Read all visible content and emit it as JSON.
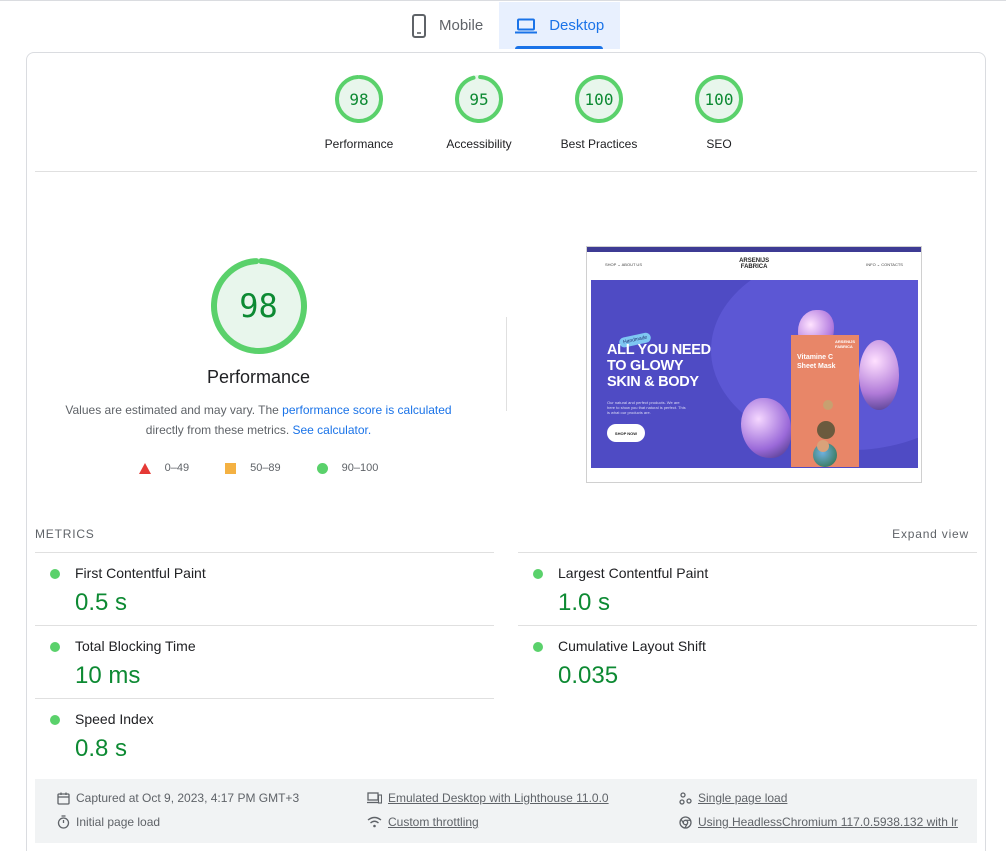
{
  "tabs": [
    {
      "label": "Mobile",
      "icon": "phone-icon",
      "active": false
    },
    {
      "label": "Desktop",
      "icon": "laptop-icon",
      "active": true
    }
  ],
  "scores": [
    {
      "value": "98",
      "label": "Performance",
      "fraction": 0.98
    },
    {
      "value": "95",
      "label": "Accessibility",
      "fraction": 0.95
    },
    {
      "value": "100",
      "label": "Best Practices",
      "fraction": 1.0
    },
    {
      "value": "100",
      "label": "SEO",
      "fraction": 1.0
    }
  ],
  "performance": {
    "score": "98",
    "fraction": 0.98,
    "title": "Performance",
    "desc_part1": "Values are estimated and may vary. The ",
    "desc_link1": "performance score is calculated",
    "desc_part2": " directly from these metrics. ",
    "desc_link2": "See calculator."
  },
  "legend": [
    {
      "range": "0–49",
      "shape": "triangle",
      "color": "#e53935"
    },
    {
      "range": "50–89",
      "shape": "square",
      "color": "#f4b142"
    },
    {
      "range": "90–100",
      "shape": "circle",
      "color": "#5ad16b"
    }
  ],
  "thumbnail": {
    "brand_line1": "ARSENIJS",
    "brand_line2": "FABRICA",
    "nav_left": "SHOP ⌄   ABOUT US",
    "nav_right": "INFO ⌄   CONTACTS",
    "badge": "Handmade",
    "hero_line1": "ALL YOU NEED",
    "hero_line2": "TO GLOWY",
    "hero_line3": "SKIN & BODY",
    "hero_small": "Our natural and perfect products. We are here to show you that natural is perfect. This is what our products are.",
    "hero_button": "SHOP NOW",
    "box_title_line1": "Vitamine C",
    "box_title_line2": "Sheet Mask",
    "box_brand_line1": "ARSENIJS",
    "box_brand_line2": "FABRICA"
  },
  "metrics": {
    "title": "METRICS",
    "expand": "Expand view",
    "left": [
      {
        "name": "First Contentful Paint",
        "value": "0.5 s"
      },
      {
        "name": "Total Blocking Time",
        "value": "10 ms"
      },
      {
        "name": "Speed Index",
        "value": "0.8 s"
      }
    ],
    "right": [
      {
        "name": "Largest Contentful Paint",
        "value": "1.0 s"
      },
      {
        "name": "Cumulative Layout Shift",
        "value": "0.035"
      }
    ]
  },
  "runtime": {
    "captured": "Captured at Oct 9, 2023, 4:17 PM GMT+3",
    "initial_load": "Initial page load",
    "emulated": "Emulated Desktop with Lighthouse 11.0.0",
    "throttling": "Custom throttling",
    "single_load": "Single page load",
    "browser": "Using HeadlessChromium 117.0.5938.132 with lr"
  },
  "colors": {
    "pass": "#0d8a33",
    "pass_ring": "#5ad16b",
    "pass_fill": "#e8f6ec",
    "accent": "#1a73e8"
  }
}
